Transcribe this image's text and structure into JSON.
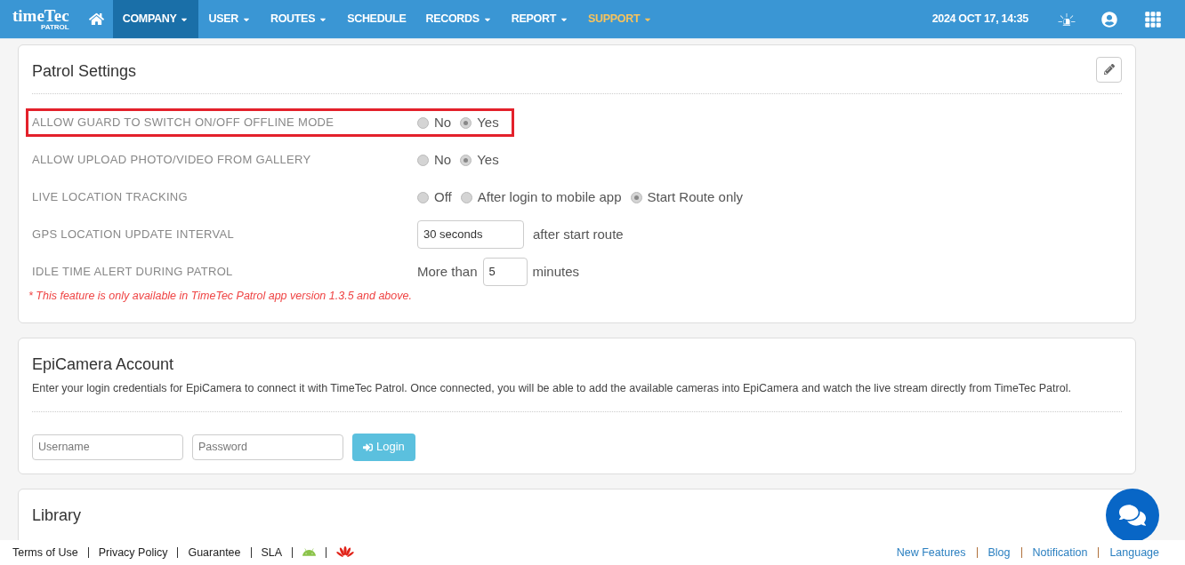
{
  "logo": {
    "name": "timeTec",
    "sub": "PATROL"
  },
  "nav": [
    {
      "label": "COMPANY",
      "selected": true,
      "dropdown": true,
      "kind": "normal"
    },
    {
      "label": "USER",
      "selected": false,
      "dropdown": true,
      "kind": "normal"
    },
    {
      "label": "ROUTES",
      "selected": false,
      "dropdown": true,
      "kind": "normal"
    },
    {
      "label": "SCHEDULE",
      "selected": false,
      "dropdown": false,
      "kind": "normal"
    },
    {
      "label": "RECORDS",
      "selected": false,
      "dropdown": true,
      "kind": "normal"
    },
    {
      "label": "REPORT",
      "selected": false,
      "dropdown": true,
      "kind": "normal"
    },
    {
      "label": "SUPPORT",
      "selected": false,
      "dropdown": true,
      "kind": "support"
    }
  ],
  "datetime": "2024 OCT 17, 14:35",
  "patrol_settings": {
    "title": "Patrol Settings",
    "rows": [
      {
        "label": "ALLOW GUARD TO SWITCH ON/OFF OFFLINE MODE",
        "kind": "radio",
        "highlighted": true,
        "options": [
          {
            "label": "No",
            "selected": false
          },
          {
            "label": "Yes",
            "selected": true
          }
        ]
      },
      {
        "label": "ALLOW UPLOAD PHOTO/VIDEO FROM GALLERY",
        "kind": "radio",
        "highlighted": false,
        "options": [
          {
            "label": "No",
            "selected": false
          },
          {
            "label": "Yes",
            "selected": true
          }
        ]
      },
      {
        "label": "LIVE LOCATION TRACKING",
        "kind": "radio",
        "highlighted": false,
        "options": [
          {
            "label": "Off",
            "selected": false
          },
          {
            "label": "After login to mobile app",
            "selected": false
          },
          {
            "label": "Start Route only",
            "selected": true
          }
        ]
      },
      {
        "label": "GPS LOCATION UPDATE INTERVAL",
        "kind": "select",
        "highlighted": false,
        "value": "30 seconds",
        "suffix": "after start route"
      },
      {
        "label": "IDLE TIME ALERT DURING PATROL",
        "kind": "number",
        "highlighted": false,
        "prefix": "More than",
        "value": "5",
        "suffix": "minutes"
      }
    ],
    "note": "* This feature is only available in TimeTec Patrol app version 1.3.5 and above."
  },
  "epicamera": {
    "title": "EpiCamera Account",
    "description": "Enter your login credentials for EpiCamera to connect it with TimeTec Patrol. Once connected, you will be able to add the available cameras into EpiCamera and watch the live stream directly from TimeTec Patrol.",
    "username": {
      "placeholder": "Username"
    },
    "password": {
      "placeholder": "Password"
    },
    "login": "Login"
  },
  "library": {
    "title": "Library"
  },
  "footer_left": [
    "Terms of Use",
    "Privacy Policy",
    "Guarantee",
    "SLA"
  ],
  "footer_right": [
    "New Features",
    "Blog",
    "Notification",
    "Language"
  ]
}
